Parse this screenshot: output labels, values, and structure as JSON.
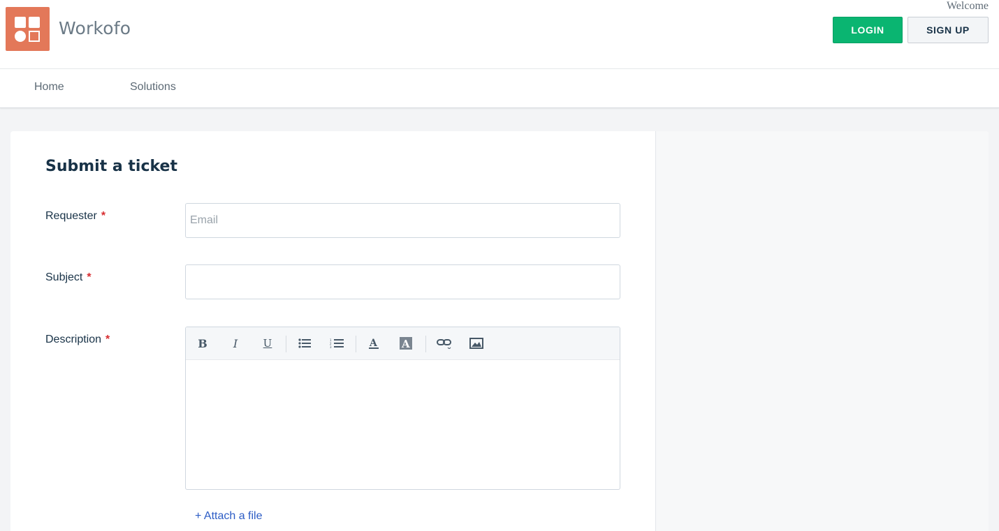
{
  "header": {
    "brand": "Workofo",
    "welcome": "Welcome",
    "login_label": "LOGIN",
    "signup_label": "SIGN UP",
    "logo_color": "#e37859",
    "login_color": "#0ab571"
  },
  "nav": {
    "items": [
      {
        "label": "Home"
      },
      {
        "label": "Solutions"
      }
    ]
  },
  "form": {
    "title": "Submit a ticket",
    "required_mark": "*",
    "requester": {
      "label": "Requester",
      "placeholder": "Email",
      "value": ""
    },
    "subject": {
      "label": "Subject",
      "placeholder": "",
      "value": ""
    },
    "description": {
      "label": "Description",
      "toolbar": [
        "bold-icon",
        "italic-icon",
        "underline-icon",
        "bulleted-list-icon",
        "numbered-list-icon",
        "font-color-icon",
        "background-color-icon",
        "link-icon",
        "image-icon"
      ]
    },
    "attach_label": "+ Attach a file"
  }
}
